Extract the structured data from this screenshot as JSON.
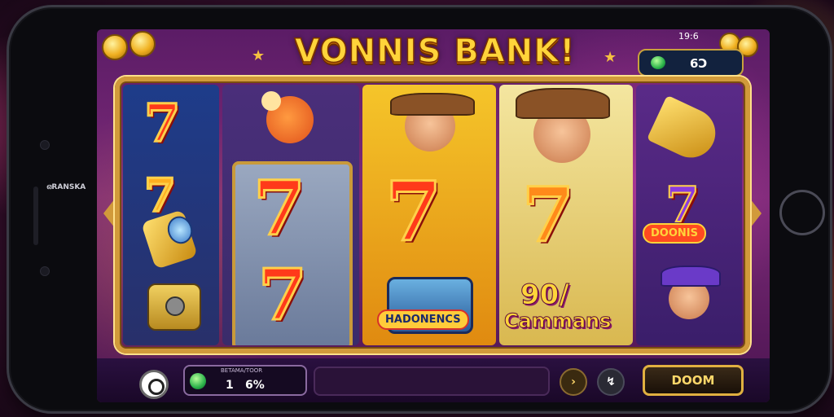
{
  "app": {
    "title": "VONNIS BANK!",
    "status_bar": "19:6",
    "balance": "6Ɔ"
  },
  "reels": {
    "seven_glyph": "7",
    "badge_left": "HADONENCS",
    "badge_right": "DOONIS",
    "win_line1": "90/",
    "win_line2": "Cammans"
  },
  "device": {
    "side_label": "ഒRANSKA"
  },
  "controls": {
    "bet_caption": "BETAMA/TOOR",
    "bet_count": "1",
    "bet_value": "6%",
    "forward_symbol": "›",
    "info_symbol": "↯",
    "spin_label": "DOOM"
  },
  "colors": {
    "gold": "#ffd43a",
    "frame": "#d19a3a",
    "screen_bg": "#5b1c66"
  }
}
